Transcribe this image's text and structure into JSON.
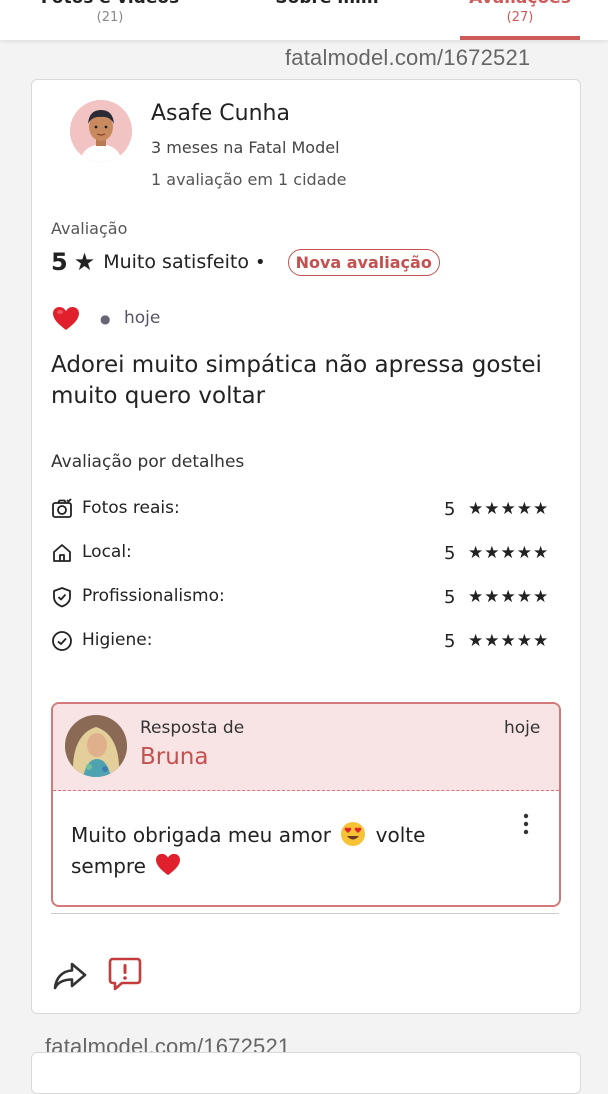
{
  "tabs": [
    {
      "label": "Fotos e vídeos",
      "count": "(21)"
    },
    {
      "label": "Sobre mim",
      "count": ""
    },
    {
      "label": "Avaliações",
      "count": "(27)"
    }
  ],
  "watermark_top": "fatalmodel.com/1672521",
  "watermark_bottom": "fatalmodel.com/1672521",
  "review": {
    "reviewer_name": "Asafe Cunha",
    "tenure": "3 meses na Fatal Model",
    "summary": "1 avaliação em 1 cidade",
    "rating_label": "Avaliação",
    "rating_value": "5",
    "rating_text": "Muito satisfeito",
    "badge": "Nova avaliação",
    "time": "hoje",
    "comment": "Adorei muito simpática não apressa gostei muito quero voltar"
  },
  "details": {
    "title": "Avaliação por detalhes",
    "items": [
      {
        "label": "Fotos reais:",
        "value": "5",
        "icon": "camera-check-icon"
      },
      {
        "label": "Local:",
        "value": "5",
        "icon": "home-icon"
      },
      {
        "label": "Profissionalismo:",
        "value": "5",
        "icon": "shield-check-icon"
      },
      {
        "label": "Higiene:",
        "value": "5",
        "icon": "check-circle-icon"
      }
    ],
    "stars": "★★★★★"
  },
  "reply": {
    "label": "Resposta de",
    "name": "Bruna",
    "time": "hoje",
    "text_before_emoji": "Muito obrigada meu amor",
    "text_after_emoji": "volte",
    "text_line2": "sempre"
  },
  "colors": {
    "accent": "#c45050",
    "reply_bg": "#f8e4e4",
    "reply_border": "#d27a7a"
  }
}
